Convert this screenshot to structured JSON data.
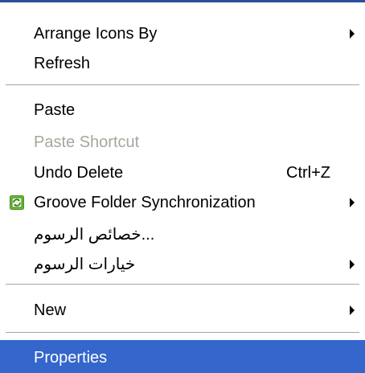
{
  "menu": {
    "items": [
      {
        "label": "Arrange Icons By",
        "submenu": true
      },
      {
        "label": "Refresh"
      },
      {
        "label": "Paste"
      },
      {
        "label": "Paste Shortcut",
        "disabled": true
      },
      {
        "label": "Undo Delete",
        "shortcut": "Ctrl+Z"
      },
      {
        "label": "Groove Folder Synchronization",
        "icon": "groove-icon",
        "submenu": true
      },
      {
        "label": "...خصائص الرسوم"
      },
      {
        "label": "خيارات الرسوم",
        "submenu": true
      },
      {
        "label": "New",
        "submenu": true
      },
      {
        "label": "Properties",
        "highlighted": true
      }
    ]
  },
  "colors": {
    "highlight": "#3466cc",
    "disabled_text": "#a7a69c",
    "separator": "#a7a69c",
    "top_border": "#2a4f9b"
  }
}
